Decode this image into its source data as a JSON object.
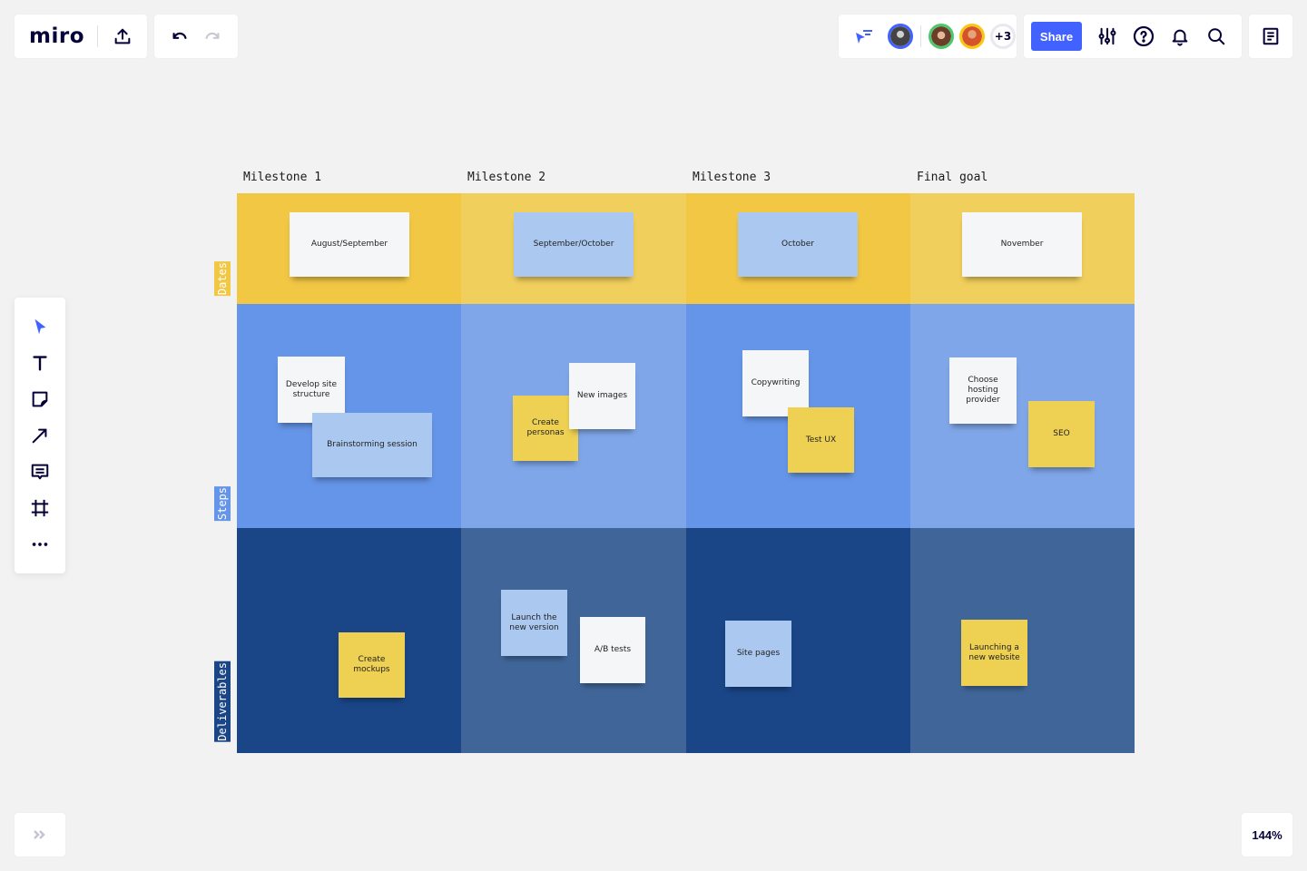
{
  "app": {
    "logo": "miro",
    "zoom_level": "144%"
  },
  "topbar": {
    "upload_icon": "upload-icon",
    "undo_icon": "undo-icon",
    "redo_icon": "redo-icon",
    "collaborators": [
      {
        "name": "collaborator-1",
        "ring": "#4262ff",
        "skin": "#5a5a5a"
      },
      {
        "name": "collaborator-2",
        "ring": "#4cc76a",
        "skin": "#9a6a50"
      },
      {
        "name": "collaborator-3",
        "ring": "#fac710",
        "skin": "#d38a5a"
      }
    ],
    "more_collaborators": "+3",
    "share_label": "Share",
    "icons": [
      "settings-sliders-icon",
      "help-icon",
      "bell-icon",
      "search-icon",
      "notes-icon"
    ]
  },
  "toolbar": {
    "tools": [
      "select",
      "text",
      "sticky-note",
      "arrow",
      "comment",
      "frame",
      "more"
    ]
  },
  "colors": {
    "accent": "#4262ff",
    "yellow_dark": "#f2c744",
    "yellow_light": "#f1cf5c",
    "blue_mid": "#6595e8",
    "blue_light": "#7fa6e8",
    "navy_dark": "#1a4587",
    "navy_light": "#406699"
  },
  "board": {
    "columns": [
      "Milestone 1",
      "Milestone 2",
      "Milestone 3",
      "Final goal"
    ],
    "rows": [
      {
        "label": "Dates",
        "label_bg": "#f2c744",
        "label_color": "#ffffff"
      },
      {
        "label": "Steps",
        "label_bg": "#6595e8",
        "label_color": "#ffffff"
      },
      {
        "label": "Deliverables",
        "label_bg": "#1a4587",
        "label_color": "#ffffff"
      }
    ],
    "stickies": {
      "dates": [
        {
          "text": "August/September",
          "color": "white"
        },
        {
          "text": "September/October",
          "color": "blue"
        },
        {
          "text": "October",
          "color": "blue"
        },
        {
          "text": "November",
          "color": "white"
        }
      ],
      "steps": [
        {
          "text": "Develop site structure",
          "color": "white"
        },
        {
          "text": "Brainstorming session",
          "color": "blue"
        },
        {
          "text": "Create personas",
          "color": "yellow"
        },
        {
          "text": "New images",
          "color": "white"
        },
        {
          "text": "Copywriting",
          "color": "white"
        },
        {
          "text": "Test UX",
          "color": "yellow"
        },
        {
          "text": "Choose hosting provider",
          "color": "white"
        },
        {
          "text": "SEO",
          "color": "yellow"
        }
      ],
      "deliverables": [
        {
          "text": "Create mockups",
          "color": "yellow"
        },
        {
          "text": "Launch the new version",
          "color": "blue"
        },
        {
          "text": "A/B tests",
          "color": "white"
        },
        {
          "text": "Site pages",
          "color": "blue"
        },
        {
          "text": "Launching a new website",
          "color": "yellow"
        }
      ]
    }
  }
}
